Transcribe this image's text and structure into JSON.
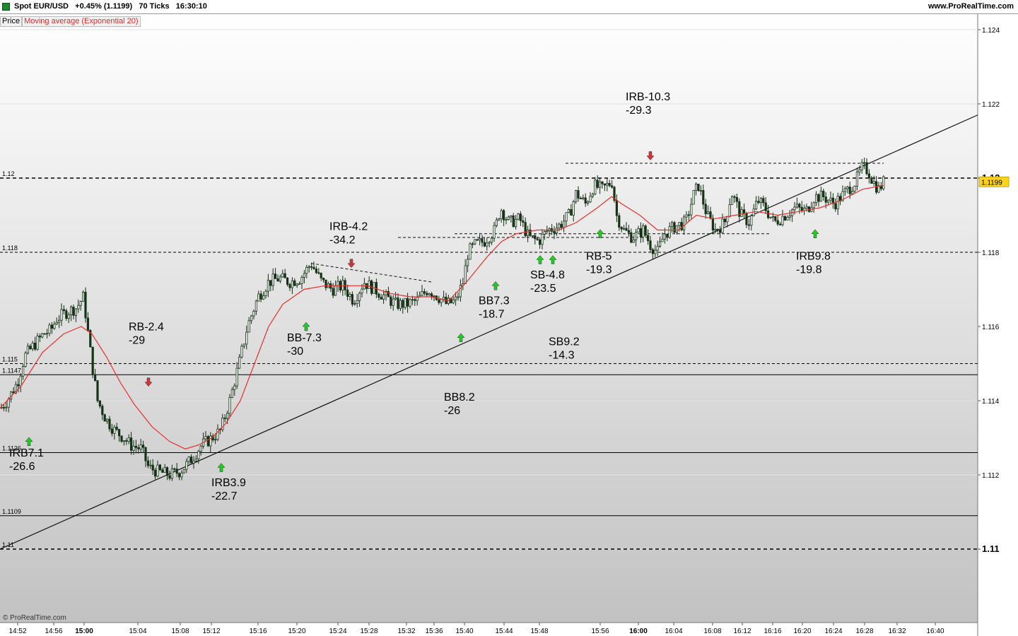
{
  "header": {
    "instrument": "Spot EUR/USD",
    "change": "+0.45% (1.1199)",
    "ticks": "70 Ticks",
    "time": "16:30:10",
    "site": "www.ProRealTime.com"
  },
  "legend": {
    "price": "Price",
    "ma": "Moving average (Exponential 20)"
  },
  "watermark": "© ProRealTime.com",
  "colors": {
    "ma": "#e8302a",
    "up_arrow": "#1fcf1f",
    "down_arrow": "#dd3030",
    "candle": "#153415",
    "bg_top": "#ffffff",
    "bg_bottom": "#c4c4c4"
  },
  "chart_data": {
    "type": "candlestick",
    "ylim": [
      1.1085,
      1.1245
    ],
    "y_ticks": [
      "1.124",
      "1.122",
      "1.12",
      "1.118",
      "1.116",
      "1.114",
      "1.112",
      "1.11"
    ],
    "x_ticks": [
      {
        "label": "14:52",
        "bold": false
      },
      {
        "label": "14:56",
        "bold": false
      },
      {
        "label": "15:00",
        "bold": true
      },
      {
        "label": "15:04",
        "bold": false
      },
      {
        "label": "15:08",
        "bold": false
      },
      {
        "label": "15:12",
        "bold": false
      },
      {
        "label": "15:16",
        "bold": false
      },
      {
        "label": "15:20",
        "bold": false
      },
      {
        "label": "15:24",
        "bold": false
      },
      {
        "label": "15:28",
        "bold": false
      },
      {
        "label": "15:32",
        "bold": false
      },
      {
        "label": "15:36",
        "bold": false
      },
      {
        "label": "15:40",
        "bold": false
      },
      {
        "label": "15:44",
        "bold": false
      },
      {
        "label": "15:48",
        "bold": false
      },
      {
        "label": "15:56",
        "bold": false
      },
      {
        "label": "16:00",
        "bold": true
      },
      {
        "label": "16:04",
        "bold": false
      },
      {
        "label": "16:08",
        "bold": false
      },
      {
        "label": "16:12",
        "bold": false
      },
      {
        "label": "16:16",
        "bold": false
      },
      {
        "label": "16:20",
        "bold": false
      },
      {
        "label": "16:24",
        "bold": false
      },
      {
        "label": "16:28",
        "bold": false
      },
      {
        "label": "16:32",
        "bold": false
      },
      {
        "label": "16:40",
        "bold": false
      }
    ],
    "current_price": "1.1199",
    "hlines": [
      {
        "value": 1.12,
        "label": "1.12",
        "style": "dashed",
        "axis_label": "1.12"
      },
      {
        "value": 1.118,
        "label": "1.118",
        "style": "dashed-thin"
      },
      {
        "value": 1.115,
        "label": "1.115",
        "style": "dashed-thin"
      },
      {
        "value": 1.1147,
        "label": "1.1147",
        "style": "solid"
      },
      {
        "value": 1.1126,
        "label": "1.1126",
        "style": "solid"
      },
      {
        "value": 1.1109,
        "label": "1.1109",
        "style": "solid"
      },
      {
        "value": 1.11,
        "label": "1.11",
        "style": "dashed",
        "axis_label": "1.11"
      }
    ],
    "price_path": [
      [
        1,
        1.1138
      ],
      [
        10,
        1.114
      ],
      [
        25,
        1.1145
      ],
      [
        35,
        1.1152
      ],
      [
        48,
        1.1155
      ],
      [
        62,
        1.1158
      ],
      [
        72,
        1.1159
      ],
      [
        80,
        1.1162
      ],
      [
        95,
        1.1164
      ],
      [
        108,
        1.1165
      ],
      [
        118,
        1.1168
      ],
      [
        122,
        1.1162
      ],
      [
        130,
        1.115
      ],
      [
        138,
        1.114
      ],
      [
        150,
        1.1135
      ],
      [
        162,
        1.1132
      ],
      [
        175,
        1.113
      ],
      [
        185,
        1.1128
      ],
      [
        200,
        1.1127
      ],
      [
        210,
        1.1122
      ],
      [
        222,
        1.1121
      ],
      [
        240,
        1.112
      ],
      [
        255,
        1.1121
      ],
      [
        270,
        1.1124
      ],
      [
        285,
        1.1128
      ],
      [
        300,
        1.113
      ],
      [
        312,
        1.1132
      ],
      [
        325,
        1.114
      ],
      [
        338,
        1.115
      ],
      [
        350,
        1.116
      ],
      [
        365,
        1.1168
      ],
      [
        380,
        1.1172
      ],
      [
        395,
        1.1173
      ],
      [
        410,
        1.1172
      ],
      [
        425,
        1.1173
      ],
      [
        440,
        1.1177
      ],
      [
        455,
        1.1172
      ],
      [
        470,
        1.117
      ],
      [
        485,
        1.1171
      ],
      [
        500,
        1.1167
      ],
      [
        515,
        1.1172
      ],
      [
        530,
        1.117
      ],
      [
        545,
        1.1168
      ],
      [
        560,
        1.1166
      ],
      [
        575,
        1.1166
      ],
      [
        590,
        1.1167
      ],
      [
        605,
        1.117
      ],
      [
        620,
        1.1168
      ],
      [
        632,
        1.1166
      ],
      [
        645,
        1.1167
      ],
      [
        655,
        1.1172
      ],
      [
        662,
        1.118
      ],
      [
        672,
        1.1182
      ],
      [
        685,
        1.1183
      ],
      [
        700,
        1.1186
      ],
      [
        708,
        1.1192
      ],
      [
        720,
        1.1188
      ],
      [
        735,
        1.1189
      ],
      [
        748,
        1.1184
      ],
      [
        762,
        1.1183
      ],
      [
        775,
        1.1186
      ],
      [
        790,
        1.1187
      ],
      [
        805,
        1.119
      ],
      [
        815,
        1.1196
      ],
      [
        828,
        1.1193
      ],
      [
        840,
        1.1198
      ],
      [
        852,
        1.1197
      ],
      [
        866,
        1.1199
      ],
      [
        872,
        1.119
      ],
      [
        882,
        1.1186
      ],
      [
        895,
        1.1184
      ],
      [
        910,
        1.1186
      ],
      [
        920,
        1.1182
      ],
      [
        930,
        1.118
      ],
      [
        940,
        1.1185
      ],
      [
        955,
        1.1187
      ],
      [
        970,
        1.1188
      ],
      [
        982,
        1.1196
      ],
      [
        988,
        1.1198
      ],
      [
        1000,
        1.119
      ],
      [
        1012,
        1.1186
      ],
      [
        1025,
        1.1188
      ],
      [
        1035,
        1.1196
      ],
      [
        1048,
        1.119
      ],
      [
        1060,
        1.1188
      ],
      [
        1072,
        1.1194
      ],
      [
        1082,
        1.1192
      ],
      [
        1095,
        1.1188
      ],
      [
        1110,
        1.119
      ],
      [
        1125,
        1.1192
      ],
      [
        1140,
        1.1191
      ],
      [
        1152,
        1.1195
      ],
      [
        1165,
        1.1195
      ],
      [
        1180,
        1.1193
      ],
      [
        1195,
        1.1196
      ],
      [
        1210,
        1.1199
      ],
      [
        1220,
        1.1203
      ],
      [
        1228,
        1.1202
      ],
      [
        1235,
        1.1199
      ],
      [
        1243,
        1.1197
      ],
      [
        1250,
        1.1199
      ]
    ],
    "ema_path": [
      [
        0,
        1.1138
      ],
      [
        30,
        1.1144
      ],
      [
        60,
        1.1153
      ],
      [
        90,
        1.1158
      ],
      [
        115,
        1.116
      ],
      [
        130,
        1.1158
      ],
      [
        150,
        1.1152
      ],
      [
        170,
        1.1145
      ],
      [
        190,
        1.1139
      ],
      [
        215,
        1.1133
      ],
      [
        240,
        1.1129
      ],
      [
        262,
        1.1127
      ],
      [
        280,
        1.1128
      ],
      [
        300,
        1.113
      ],
      [
        320,
        1.1134
      ],
      [
        340,
        1.114
      ],
      [
        360,
        1.115
      ],
      [
        380,
        1.116
      ],
      [
        400,
        1.1166
      ],
      [
        430,
        1.117
      ],
      [
        460,
        1.1171
      ],
      [
        490,
        1.1171
      ],
      [
        520,
        1.1171
      ],
      [
        550,
        1.1169
      ],
      [
        580,
        1.1168
      ],
      [
        610,
        1.1168
      ],
      [
        635,
        1.1167
      ],
      [
        660,
        1.1172
      ],
      [
        690,
        1.1179
      ],
      [
        710,
        1.1183
      ],
      [
        730,
        1.1185
      ],
      [
        760,
        1.1186
      ],
      [
        790,
        1.1186
      ],
      [
        815,
        1.1188
      ],
      [
        845,
        1.1192
      ],
      [
        865,
        1.1195
      ],
      [
        880,
        1.1193
      ],
      [
        905,
        1.119
      ],
      [
        930,
        1.1186
      ],
      [
        960,
        1.1186
      ],
      [
        985,
        1.119
      ],
      [
        1010,
        1.1189
      ],
      [
        1040,
        1.119
      ],
      [
        1070,
        1.1191
      ],
      [
        1100,
        1.119
      ],
      [
        1130,
        1.1191
      ],
      [
        1160,
        1.1192
      ],
      [
        1190,
        1.1194
      ],
      [
        1220,
        1.1197
      ],
      [
        1250,
        1.1198
      ]
    ],
    "trendline": {
      "from": [
        0,
        1.11
      ],
      "to": [
        1383,
        1.1217
      ]
    },
    "dashed_levels": [
      {
        "x1": 800,
        "x2": 1250,
        "value": 1.1204
      },
      {
        "x1": 563,
        "x2": 915,
        "value": 1.1184
      },
      {
        "x1": 643,
        "x2": 1088,
        "value": 1.1185
      },
      {
        "x1": 440,
        "x2": 610,
        "value": 1.1177,
        "value2": 1.1172
      }
    ],
    "arrows": [
      {
        "x": 41,
        "value": 1.1129,
        "dir": "up"
      },
      {
        "x": 210,
        "value": 1.1145,
        "dir": "down"
      },
      {
        "x": 313,
        "value": 1.1122,
        "dir": "up"
      },
      {
        "x": 433,
        "value": 1.116,
        "dir": "up"
      },
      {
        "x": 497,
        "value": 1.1177,
        "dir": "down"
      },
      {
        "x": 652,
        "value": 1.1157,
        "dir": "up"
      },
      {
        "x": 701,
        "value": 1.1171,
        "dir": "up"
      },
      {
        "x": 764,
        "value": 1.1178,
        "dir": "up"
      },
      {
        "x": 782,
        "value": 1.1178,
        "dir": "up"
      },
      {
        "x": 849,
        "value": 1.1185,
        "dir": "up"
      },
      {
        "x": 920,
        "value": 1.1206,
        "dir": "down"
      },
      {
        "x": 1153,
        "value": 1.1185,
        "dir": "up"
      }
    ],
    "annotations": [
      {
        "x": 13,
        "value": 1.1125,
        "line1": "IRB7.1",
        "line2": "-26.6"
      },
      {
        "x": 182,
        "value": 1.1159,
        "line1": "RB-2.4",
        "line2": "-29"
      },
      {
        "x": 299,
        "value": 1.1117,
        "line1": "IRB3.9",
        "line2": "-22.7"
      },
      {
        "x": 406,
        "value": 1.1156,
        "line1": "BB-7.3",
        "line2": "-30"
      },
      {
        "x": 466,
        "value": 1.1186,
        "line1": "IRB-4.2",
        "line2": "-34.2"
      },
      {
        "x": 628,
        "value": 1.114,
        "line1": "BB8.2",
        "line2": "-26"
      },
      {
        "x": 677,
        "value": 1.1166,
        "line1": "BB7.3",
        "line2": "-18.7"
      },
      {
        "x": 750,
        "value": 1.1173,
        "line1": "SB-4.8",
        "line2": "-23.5"
      },
      {
        "x": 776,
        "value": 1.1155,
        "line1": "SB9.2",
        "line2": "-14.3"
      },
      {
        "x": 829,
        "value": 1.1178,
        "line1": "RB-5",
        "line2": "-19.3"
      },
      {
        "x": 885,
        "value": 1.1221,
        "line1": "IRB-10.3",
        "line2": "-29.3"
      },
      {
        "x": 1126,
        "value": 1.1178,
        "line1": "IRB9.8",
        "line2": "-19.8"
      }
    ]
  }
}
